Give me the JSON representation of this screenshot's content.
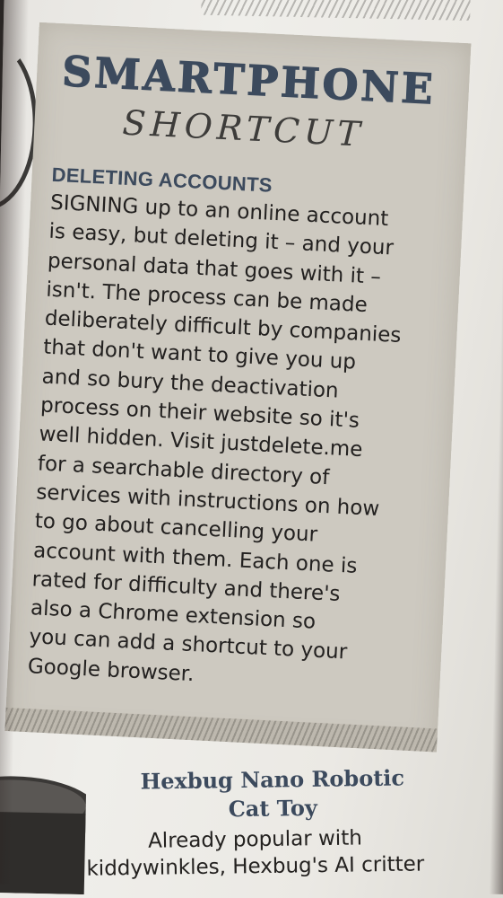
{
  "article": {
    "title_main": "SMARTPHONE",
    "title_sub": "SHORTCUT",
    "heading": "DELETING ACCOUNTS",
    "body": "SIGNING up to an online account\nis easy, but deleting it – and your\npersonal data that goes with it –\nisn't. The process can be made\ndeliberately difficult by companies\nthat don't want to give you up\nand so bury the deactivation\nprocess on their website so it's\nwell hidden. Visit justdelete.me\nfor a searchable directory of\nservices with instructions on how\nto go about cancelling your\naccount with them. Each one is\nrated for difficulty and there's\nalso a Chrome extension so\nyou can add a shortcut to your\nGoogle browser."
  },
  "next_item": {
    "title": "Hexbug Nano Robotic\nCat Toy",
    "description": "Already popular with\nkiddywinkles, Hexbug's AI critter"
  }
}
